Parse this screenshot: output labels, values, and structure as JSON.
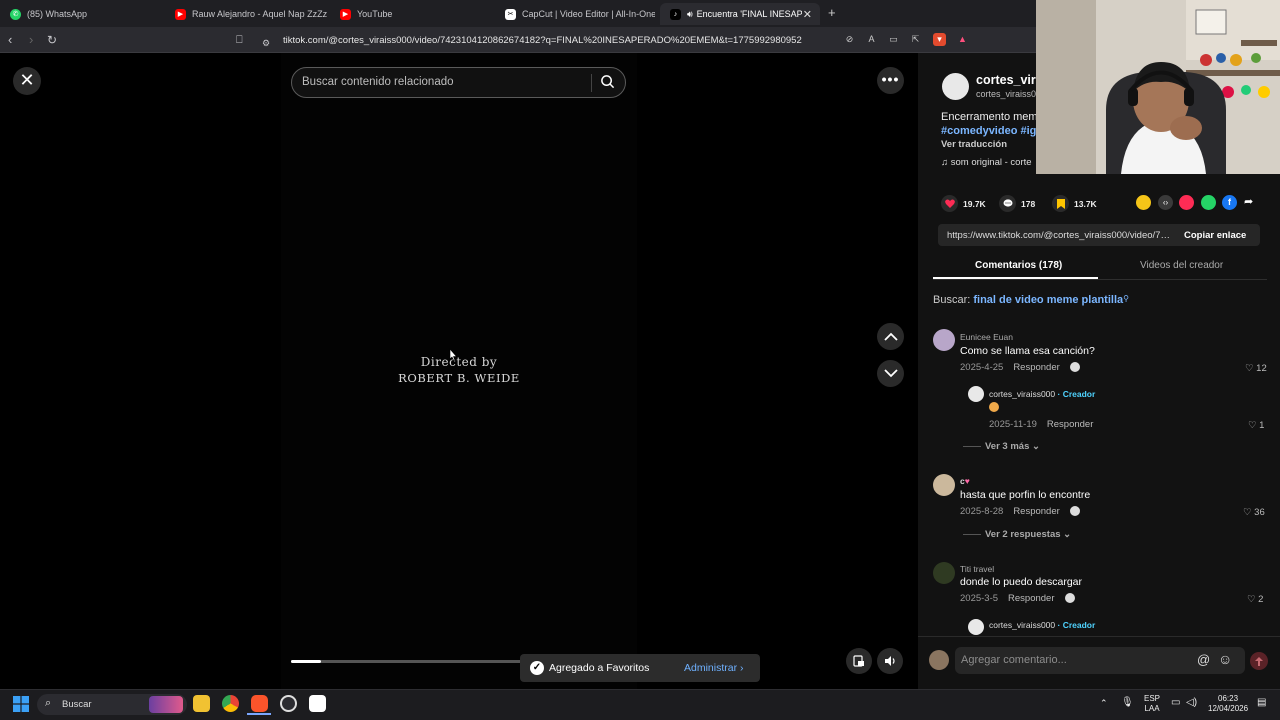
{
  "browser": {
    "tabs": [
      {
        "label": "(85) WhatsApp",
        "icon": "whatsapp-icon"
      },
      {
        "label": "Rauw Alejandro - Aquel Nap ZzZz (Le",
        "icon": "youtube-icon"
      },
      {
        "label": "YouTube",
        "icon": "youtube-icon"
      },
      {
        "label": "CapCut | Video Editor | All-In-One Vi",
        "icon": "capcut-icon"
      },
      {
        "label": "Encuentra 'FINAL INESAPERA",
        "icon": "tiktok-icon"
      }
    ],
    "new_tab": "+",
    "url": "tiktok.com/@cortes_viraiss000/video/7423104120862674182?q=FINAL%20INESAPERADO%20EMEM&t=1775992980952"
  },
  "player": {
    "search_placeholder": "Buscar contenido relacionado",
    "credit_line1": "Directed by",
    "credit_line2": "ROBERT B. WEIDE",
    "progress": 0.09,
    "toast_message": "Agregado a Favoritos",
    "toast_action": "Administrar"
  },
  "post": {
    "creator_name": "cortes_virai",
    "creator_handle": "cortes_viraiss0",
    "description": "Encerramento mem",
    "hashtags": "#comedyvideo #ig",
    "translate": "Ver traducción",
    "sound": "som original - corte",
    "likes": "19.7K",
    "comments": "178",
    "saves": "13.7K",
    "share_link": "https://www.tiktok.com/@cortes_viraiss000/video/7423104120862674182",
    "copy_link": "Copiar enlace"
  },
  "panel_tabs": {
    "comments": "Comentarios (178)",
    "creator_videos": "Videos del creador"
  },
  "related": {
    "prefix": "Buscar:",
    "query": "final de video meme plantilla"
  },
  "comments": [
    {
      "user": "Eunicee Euan",
      "text": "Como se llama esa canción?",
      "date": "2025-4-25",
      "reply": "Responder",
      "likes": "12"
    },
    {
      "user": "cortes_viraiss000",
      "badge": "· Creador",
      "text": "",
      "date": "2025-11-19",
      "reply": "Responder",
      "likes": "1"
    },
    {
      "more": "Ver 3 más"
    },
    {
      "user": "c",
      "text": "hasta que porfin lo encontre",
      "date": "2025-8-28",
      "reply": "Responder",
      "likes": "36"
    },
    {
      "more": "Ver 2 respuestas"
    },
    {
      "user": "Titi travel",
      "text": "donde lo puedo descargar",
      "date": "2025-3-5",
      "reply": "Responder",
      "likes": "2"
    },
    {
      "user": "cortes_viraiss000",
      "badge": "· Creador"
    }
  ],
  "comment_input_placeholder": "Agregar comentario...",
  "taskbar": {
    "search": "Buscar",
    "lang1": "ESP",
    "lang2": "LAA",
    "time": "06:23",
    "date": "12/04/2026"
  },
  "colors": {
    "tiktok_red": "#fe2c55",
    "link_blue": "#7bb6ff",
    "creator_cyan": "#4fd3ff",
    "save_yellow": "#ffc500"
  }
}
